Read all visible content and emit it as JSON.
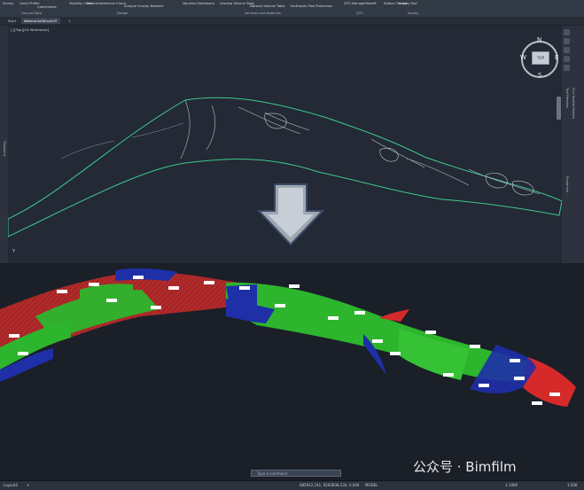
{
  "ribbon": {
    "items": [
      "Survey",
      "Quick Profile",
      "Catchments",
      "Visibility Check",
      "Drive",
      "Interference Check",
      "Analyze Gravity Network",
      "Volumes Dashboard",
      "Grading Volume Tools",
      "Material Volume Table",
      "Earthwork Plan Production",
      "QTO Manager",
      "Takeoff",
      "Station Tracker",
      "Inquiry Tool"
    ],
    "groups": [
      "Ground Data",
      "Design",
      "Volumes and Materials",
      "QTO",
      "Inquiry"
    ]
  },
  "tabs": [
    "Start",
    "WatershedTerrain3*",
    "+"
  ],
  "viewport": {
    "label": "[-][Top][2D Wireframe]",
    "compass": {
      "n": "N",
      "s": "S",
      "w": "W",
      "e": "E",
      "top": "TOP"
    }
  },
  "sidepanels": {
    "left": "Toolspace",
    "right1": "Tool Palettes",
    "right2": "Civil Spatial Pattern",
    "right3": "Properties"
  },
  "command": {
    "placeholder": "Type a command"
  },
  "layout_tab": "Layout2",
  "status": {
    "coords": "685912.241, 9292838.234, 0.000",
    "model": "MODEL",
    "scale": "1:1000",
    "zoom": "3.500"
  },
  "watermark": "公众号 · Bimfilm",
  "colors": {
    "accent": "#3ec98a",
    "cut": "#b22a2a",
    "fill": "#2db52d",
    "water": "#1e2fa8",
    "label": "#ffffff"
  }
}
